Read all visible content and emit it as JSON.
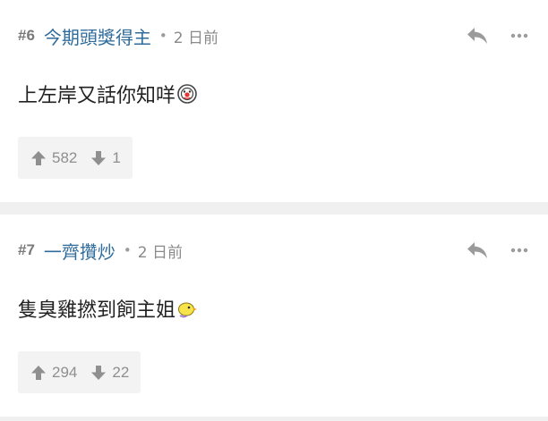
{
  "posts": [
    {
      "floor": "#6",
      "username": "今期頭獎得主",
      "separator": "•",
      "time": "2 日前",
      "content": "上左岸又話你知咩",
      "emoji": "clown-face-icon",
      "upvotes": "582",
      "downvotes": "1"
    },
    {
      "floor": "#7",
      "username": "一齊攢炒",
      "separator": "•",
      "time": "2 日前",
      "content": "隻臭雞撚到飼主姐",
      "emoji": "yellow-chick-icon",
      "upvotes": "294",
      "downvotes": "22"
    }
  ],
  "icons": {
    "reply": "reply-icon",
    "more": "more-icon",
    "upvote": "arrow-up-icon",
    "downvote": "arrow-down-icon"
  },
  "colors": {
    "username": "#2f6c9c",
    "meta_text": "#8a8a8a",
    "vote_bg": "#f3f3f3",
    "separator_bg": "#f0f0f0",
    "icon_gray": "#9b9b9b"
  }
}
